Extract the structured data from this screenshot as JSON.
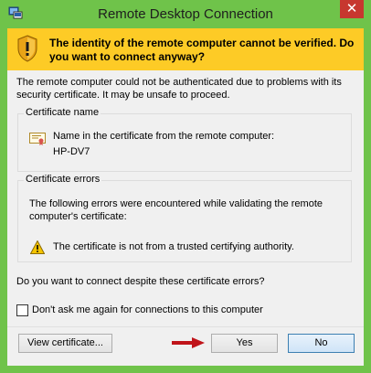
{
  "window": {
    "title": "Remote Desktop Connection",
    "close_glyph": "✕"
  },
  "header": {
    "warning": "The identity of the remote computer cannot be verified. Do you want to connect anyway?"
  },
  "message": "The remote computer could not be authenticated due to problems with its security certificate. It may be unsafe to proceed.",
  "certificate_name": {
    "label": "Certificate name",
    "line1": "Name in the certificate from the remote computer:",
    "name": "HP-DV7"
  },
  "certificate_errors": {
    "label": "Certificate errors",
    "intro": "The following errors were encountered while validating the remote computer's certificate:",
    "error1": "The certificate is not from a trusted certifying authority."
  },
  "question": "Do you want to connect despite these certificate errors?",
  "checkbox": {
    "label": "Don't ask me again for connections to this computer",
    "checked": false
  },
  "buttons": {
    "view": "View certificate...",
    "yes": "Yes",
    "no": "No"
  },
  "colors": {
    "titlebar": "#6fc34a",
    "warning_band": "#fdcb26",
    "close_button": "#c7372f",
    "arrow": "#c0141a"
  },
  "icons": {
    "app": "remote-desktop-icon",
    "header": "shield-warning-icon",
    "certificate": "certificate-icon",
    "error": "warning-triangle-icon",
    "pointer": "red-arrow-icon"
  }
}
